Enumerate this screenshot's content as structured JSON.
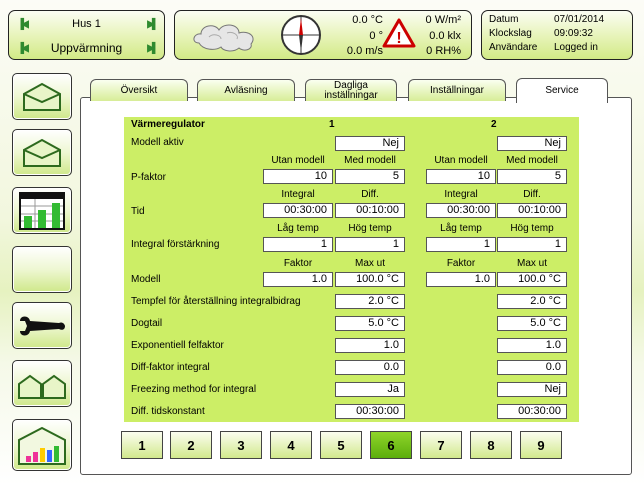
{
  "location": {
    "name": "Hus 1",
    "mode": "Uppvärmning"
  },
  "weather": {
    "temp": "0.0 °C",
    "wind_dir": "0 °",
    "wind_speed": "0.0 m/s",
    "radiation": "0 W/m²",
    "light": "0.0 klx",
    "humidity": "0 RH%"
  },
  "datetime": {
    "date_label": "Datum",
    "date": "07/01/2014",
    "time_label": "Klockslag",
    "time": "09:09:32",
    "user_label": "Användare",
    "user": "Logged in"
  },
  "tabs": [
    "Översikt",
    "Avläsning",
    "Dagliga inställningar",
    "Inställningar",
    "Service"
  ],
  "active_tab": "Service",
  "regulator": {
    "title": "Värmeregulator",
    "col1": "1",
    "col2": "2",
    "rows": {
      "modell_aktiv": {
        "label": "Modell aktiv",
        "v1": "Nej",
        "v2": "Nej"
      },
      "p_faktor": {
        "label": "P-faktor",
        "h1": "Utan modell",
        "h2": "Med modell",
        "a1": "10",
        "b1": "5",
        "a2": "10",
        "b2": "5"
      },
      "tid": {
        "label": "Tid",
        "h1": "Integral",
        "h2": "Diff.",
        "a1": "00:30:00",
        "b1": "00:10:00",
        "a2": "00:30:00",
        "b2": "00:10:00"
      },
      "integral_forst": {
        "label": "Integral förstärkning",
        "h1": "Låg temp",
        "h2": "Hög temp",
        "a1": "1",
        "b1": "1",
        "a2": "1",
        "b2": "1"
      },
      "modell": {
        "label": "Modell",
        "h1": "Faktor",
        "h2": "Max ut",
        "a1": "1.0",
        "b1": "100.0 °C",
        "a2": "1.0",
        "b2": "100.0 °C"
      },
      "tempfel": {
        "label": "Tempfel för återställning integralbidrag",
        "v1": "2.0 °C",
        "v2": "2.0 °C"
      },
      "dogtail": {
        "label": "Dogtail",
        "v1": "5.0 °C",
        "v2": "5.0 °C"
      },
      "exp_felfaktor": {
        "label": "Exponentiell felfaktor",
        "v1": "1.0",
        "v2": "1.0"
      },
      "diff_faktor": {
        "label": "Diff-faktor integral",
        "v1": "0.0",
        "v2": "0.0"
      },
      "freezing": {
        "label": "Freezing method for integral",
        "v1": "Ja",
        "v2": "Nej"
      },
      "diff_tid": {
        "label": "Diff. tidskonstant",
        "v1": "00:30:00",
        "v2": "00:30:00"
      }
    }
  },
  "pages": [
    "1",
    "2",
    "3",
    "4",
    "5",
    "6",
    "7",
    "8",
    "9"
  ],
  "active_page": "6",
  "colors": {
    "accent": "#ccee66",
    "active_page": "#6cbf14",
    "warning": "#cc0000"
  }
}
